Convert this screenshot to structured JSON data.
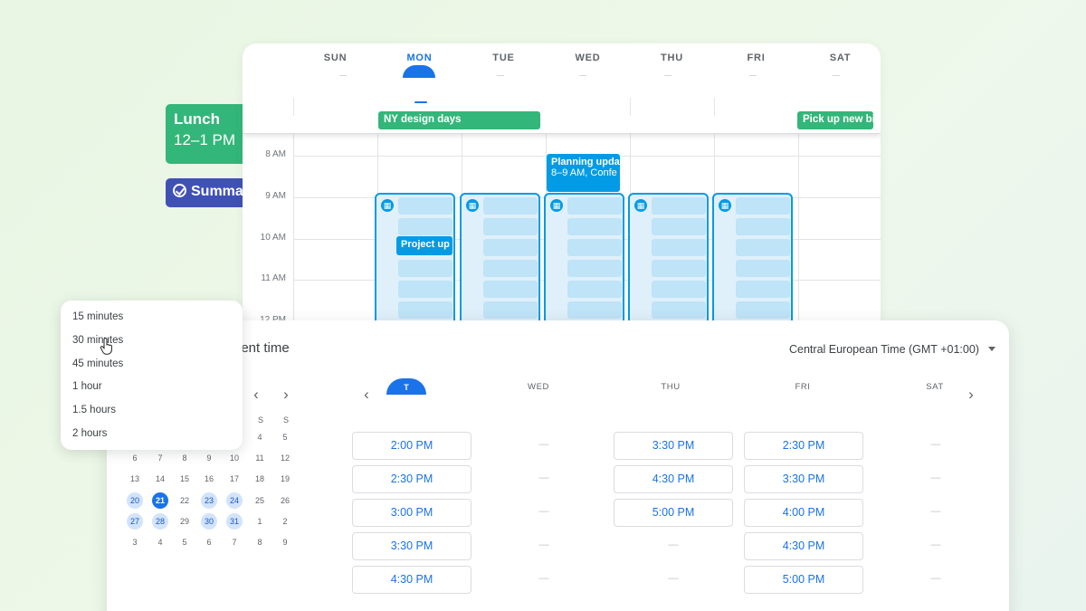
{
  "week": {
    "days": [
      "SUN",
      "MON",
      "TUE",
      "WED",
      "THU",
      "FRI",
      "SAT"
    ],
    "active_day": "MON",
    "all_day_events": [
      "NY design days",
      "Pick up new bi"
    ],
    "time_labels": [
      "8 AM",
      "9 AM",
      "10 AM",
      "11 AM",
      "12 PM"
    ],
    "events": {
      "planning_title": "Planning upda",
      "planning_sub": "8–9 AM, Confe",
      "project_title": "Project up"
    }
  },
  "chips": {
    "lunch_title": "Lunch",
    "lunch_time": "12–1 PM",
    "summary_label": "Summa"
  },
  "booking": {
    "title": "nent time",
    "timezone": "Central European Time (GMT +01:00)",
    "mini_cal": {
      "dow_visible": [
        "S",
        "S"
      ],
      "rows": [
        [
          "",
          "",
          "",
          "",
          "",
          "4",
          "5"
        ],
        [
          "6",
          "7",
          "8",
          "9",
          "10",
          "11",
          "12"
        ],
        [
          "13",
          "14",
          "15",
          "16",
          "17",
          "18",
          "19"
        ],
        [
          "20",
          "21",
          "22",
          "23",
          "24",
          "25",
          "26"
        ],
        [
          "27",
          "28",
          "29",
          "30",
          "31",
          "1",
          "2"
        ],
        [
          "3",
          "4",
          "5",
          "6",
          "7",
          "8",
          "9"
        ]
      ],
      "selected": "21",
      "available": [
        "20",
        "23",
        "24",
        "27",
        "28",
        "30",
        "31"
      ]
    },
    "columns": [
      {
        "head": "T",
        "times": [
          "2:00 PM",
          "2:30 PM",
          "3:00 PM",
          "3:30 PM",
          "4:30 PM"
        ]
      },
      {
        "head": "WED",
        "times": []
      },
      {
        "head": "THU",
        "times": [
          "3:30 PM",
          "4:30 PM",
          "5:00 PM"
        ]
      },
      {
        "head": "FRI",
        "times": [
          "2:30 PM",
          "3:30 PM",
          "4:00 PM",
          "4:30 PM",
          "5:00 PM"
        ]
      },
      {
        "head": "SAT",
        "times": []
      }
    ],
    "dash": "—"
  },
  "duration_menu": {
    "options": [
      "15 minutes",
      "30 minutes",
      "45 minutes",
      "1 hour",
      "1.5 hours",
      "2 hours"
    ],
    "hovered": "30 minutes"
  },
  "colors": {
    "green_event": "#33b679",
    "blue_event": "#039be5",
    "summary_chip": "#3f51b5",
    "primary": "#1a73e8"
  }
}
